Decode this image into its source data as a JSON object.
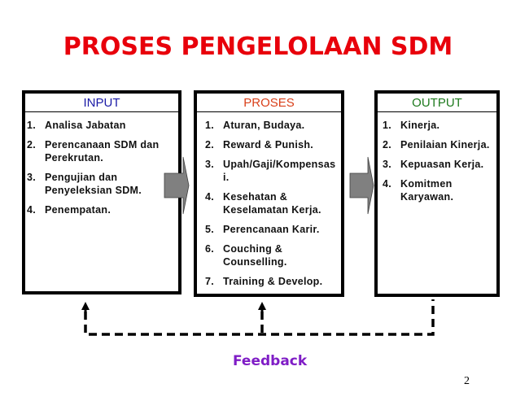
{
  "title": "PROSES PENGELOLAAN SDM",
  "columns": {
    "input": {
      "header": "INPUT",
      "header_color": "#1a1aa6",
      "items": [
        {
          "num": "1.",
          "text": "Analisa Jabatan"
        },
        {
          "num": "2.",
          "text": "Perencanaan SDM dan Perekrutan."
        },
        {
          "num": "3.",
          "text": "Pengujian dan Penyeleksian SDM."
        },
        {
          "num": "4.",
          "text": "Penempatan."
        }
      ]
    },
    "proses": {
      "header": "PROSES",
      "header_color": "#d9401a",
      "items": [
        {
          "num": "1.",
          "text": "Aturan, Budaya."
        },
        {
          "num": "2.",
          "text": "Reward & Punish."
        },
        {
          "num": "3.",
          "text": "Upah/Gaji/Kompensasi."
        },
        {
          "num": "4.",
          "text": "Kesehatan & Keselamatan Kerja."
        },
        {
          "num": "5.",
          "text": "Perencanaan Karir."
        },
        {
          "num": "6.",
          "text": "Couching & Counselling."
        },
        {
          "num": "7.",
          "text": "Training & Develop."
        }
      ]
    },
    "output": {
      "header": "OUTPUT",
      "header_color": "#1e7a1e",
      "items": [
        {
          "num": "1.",
          "text": "Kinerja."
        },
        {
          "num": "2.",
          "text": "Penilaian Kinerja."
        },
        {
          "num": "3.",
          "text": "Kepuasan Kerja."
        },
        {
          "num": "4.",
          "text": "Komitmen Karyawan."
        }
      ]
    }
  },
  "flow": {
    "arrow_icon": "block-arrow-right-icon",
    "arrow_color": "#808080",
    "feedback_loop": "dashed-line-loop",
    "feedback_label": "Feedback",
    "feedback_color": "#7f1dc6"
  },
  "title_color": "#e8000b",
  "page_number": "2"
}
